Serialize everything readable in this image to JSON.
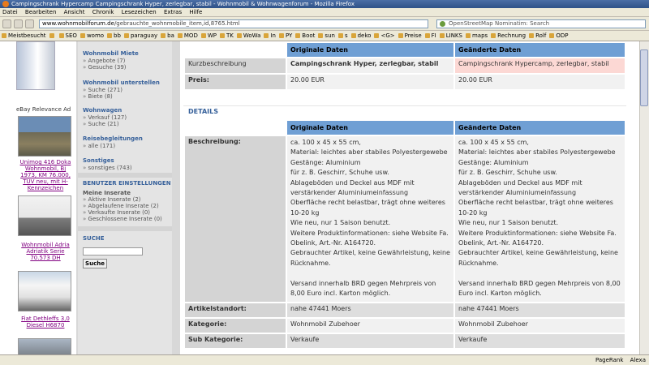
{
  "window": {
    "title": "Campingschrank Hypercamp Campingschrank Hyper, zerlegbar, stabil - Wohnmobil & Wohnwagenforum - Mozilla Firefox"
  },
  "menu": [
    "Datei",
    "Bearbeiten",
    "Ansicht",
    "Chronik",
    "Lesezeichen",
    "Extras",
    "Hilfe"
  ],
  "address": {
    "domain": "www.wohnmobilforum.de",
    "path": "/gebrauchte_wohnmobile_item,id,8765.html"
  },
  "search": {
    "placeholder": "OpenStreetMap Nominatim: Search"
  },
  "bookmarks": [
    "Meistbesucht",
    "",
    "SEO",
    "womo",
    "bb",
    "paraguay",
    "ba",
    "MOD",
    "WP",
    "TK",
    "WoWa",
    "In",
    "PY",
    "Boot",
    "sun",
    "s",
    "deko",
    "<G>",
    "Preise",
    "FI",
    "LINKS",
    "maps",
    "Rechnung",
    "Rolf",
    "ODP"
  ],
  "left_ads": {
    "heading": "eBay Relevance Ad",
    "items": [
      {
        "text": "Unimog 416 Doka Wohnmobil, Bj 1973, KM 76.000, TÜV neu, mit H-Kennzeichen"
      },
      {
        "text": "Wohnmobil Adria Adriatik Serie 70.573 DH"
      },
      {
        "text": "Fiat Dethleffs 3,0 Diesel H6870"
      }
    ]
  },
  "nav": {
    "miete": {
      "title": "Wohnmobil Miete",
      "items": [
        "Angebote (7)",
        "Gesuche (39)"
      ]
    },
    "unterstellen": {
      "title": "Wohnmobil unterstellen",
      "items": [
        "Suche (271)",
        "Biete (8)"
      ]
    },
    "wohnwagen": {
      "title": "Wohnwagen",
      "items": [
        "Verkauf (127)",
        "Suche (21)"
      ]
    },
    "reise": {
      "title": "Reisebegleitungen",
      "items": [
        "alle (171)"
      ]
    },
    "sonstiges": {
      "title": "Sonstiges",
      "items": [
        "sonstiges (743)"
      ]
    },
    "settings": {
      "title": "BENUTZER EINSTELLUNGEN",
      "sub": "Meine Inserate",
      "items": [
        "Aktive Inserate (2)",
        "Abgelaufene Inserate (2)",
        "Verkaufte Inserate (0)",
        "Geschlossene Inserate (0)"
      ]
    },
    "search": {
      "title": "SUCHE",
      "button": "Suche"
    }
  },
  "top_table": {
    "col_orig": "Originale Daten",
    "col_new": "Geänderte Daten",
    "rows": [
      {
        "label": "Kurzbeschreibung",
        "orig": "Campingschrank Hyper, zerlegbar, stabil",
        "new": "Campingschrank Hypercamp, zerlegbar, stabil"
      },
      {
        "label": "Preis:",
        "orig": "20.00 EUR",
        "new": "20.00 EUR"
      }
    ]
  },
  "details": {
    "heading": "DETAILS",
    "col_orig": "Originale Daten",
    "col_new": "Geänderte Daten",
    "beschreibung_label": "Beschreibung:",
    "beschreibung_orig": "ca. 100 x 45 x 55 cm,\nMaterial: leichtes aber stabiles Polyestergewebe\nGestänge: Aluminium\nfür z. B. Geschirr, Schuhe usw.\nAblageböden und Deckel aus MDF mit verstärkender Aluminiumeinfassung\nOberfläche recht belastbar, trägt ohne weiteres 10-20 kg\nWie neu, nur 1 Saison benutzt.\nWeitere Produktinformationen: siehe Website Fa. Obelink, Art.-Nr. A164720.\nGebrauchter Artikel, keine Gewährleistung, keine Rücknahme.\n\nVersand innerhalb BRD gegen Mehrpreis von 8,00 Euro incl. Karton möglich.",
    "beschreibung_new": "ca. 100 x 45 x 55 cm,\nMaterial: leichtes aber stabiles Polyestergewebe\nGestänge: Aluminium\nfür z. B. Geschirr, Schuhe usw.\nAblageböden und Deckel aus MDF mit verstärkender Aluminiumeinfassung\nOberfläche recht belastbar, trägt ohne weiteres 10-20 kg\nWie neu, nur 1 Saison benutzt.\nWeitere Produktinformationen: siehe Website Fa. Obelink, Art.-Nr. A164720.\nGebrauchter Artikel, keine Gewährleistung, keine Rücknahme.\n\nVersand innerhalb BRD gegen Mehrpreis von 8,00 Euro incl. Karton möglich.",
    "rows": [
      {
        "label": "Artikelstandort:",
        "orig": "nahe 47441 Moers",
        "new": "nahe 47441 Moers"
      },
      {
        "label": "Kategorie:",
        "orig": "Wohnmobil Zubehoer",
        "new": "Wohnmobil Zubehoer"
      },
      {
        "label": "Sub Kategorie:",
        "orig": "Verkaufe",
        "new": "Verkaufe"
      }
    ]
  },
  "status": {
    "items": [
      "PageRank",
      "Alexa",
      ""
    ]
  },
  "colors": {
    "header_blue": "#6f9fd4",
    "changed_pink": "#fcd8d4",
    "nav_link": "#36609a"
  }
}
